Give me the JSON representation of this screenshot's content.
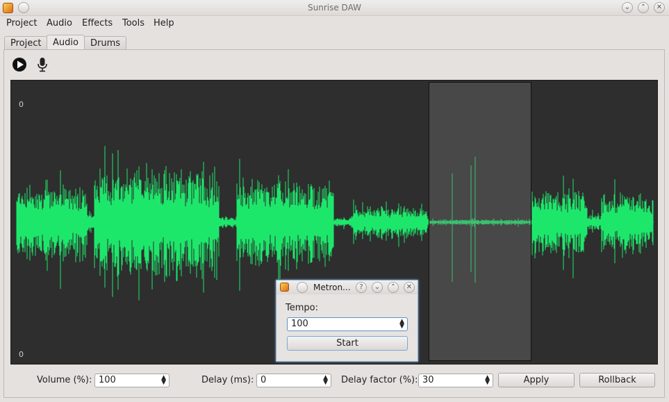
{
  "window": {
    "title": "Sunrise DAW"
  },
  "menu": [
    {
      "label": "Project"
    },
    {
      "label": "Audio"
    },
    {
      "label": "Effects"
    },
    {
      "label": "Tools"
    },
    {
      "label": "Help"
    }
  ],
  "tabs": [
    {
      "label": "Project",
      "active": false
    },
    {
      "label": "Audio",
      "active": true
    },
    {
      "label": "Drums",
      "active": false
    }
  ],
  "toolbar": {
    "play_icon": "play-icon",
    "record_icon": "microphone-icon"
  },
  "waveform": {
    "axis_top": "0",
    "axis_bottom": "0",
    "color": "#1de76b",
    "background": "#2e2e2e"
  },
  "metronome": {
    "title": "Metron...",
    "tempo_label": "Tempo:",
    "tempo_value": "100",
    "start_label": "Start"
  },
  "controls": {
    "volume_label": "Volume (%):",
    "volume_value": "100",
    "delay_label": "Delay (ms):",
    "delay_value": "0",
    "delay_factor_label": "Delay factor (%):",
    "delay_factor_value": "30",
    "apply_label": "Apply",
    "rollback_label": "Rollback"
  }
}
